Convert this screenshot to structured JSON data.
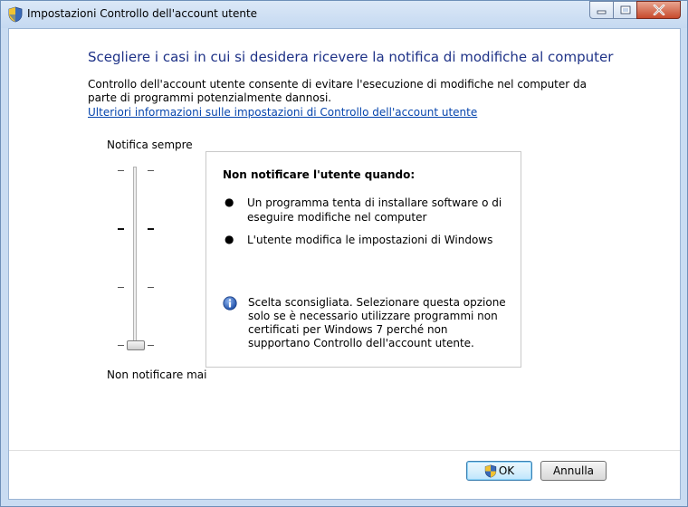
{
  "window": {
    "title": "Impostazioni Controllo dell'account utente",
    "controls": [
      "minimize",
      "maximize",
      "close"
    ]
  },
  "main": {
    "heading": "Scegliere i casi in cui si desidera ricevere la notifica di modifiche al computer",
    "description": "Controllo dell'account utente consente di evitare l'esecuzione di modifiche nel computer da parte di programmi potenzialmente dannosi.",
    "link": "Ulteriori informazioni sulle impostazioni di Controllo dell'account utente"
  },
  "slider": {
    "top_label": "Notifica sempre",
    "bottom_label": "Non notificare mai",
    "levels": 4,
    "selected_level": 1
  },
  "panel": {
    "title": "Non notificare l'utente quando:",
    "bullets": [
      "Un programma tenta di installare software o di eseguire modifiche nel computer",
      "L'utente modifica le impostazioni di Windows"
    ],
    "info": "Scelta sconsigliata. Selezionare questa opzione solo se è necessario utilizzare programmi non certificati per Windows 7 perché non supportano Controllo dell'account utente."
  },
  "buttons": {
    "ok": "OK",
    "cancel": "Annulla"
  },
  "colors": {
    "heading": "#1e3287",
    "link": "#0645ad",
    "ok_border": "#3c7fb1"
  },
  "icons": {
    "title": "uac-shield-icon",
    "info": "info-icon",
    "ok": "uac-shield-icon"
  }
}
